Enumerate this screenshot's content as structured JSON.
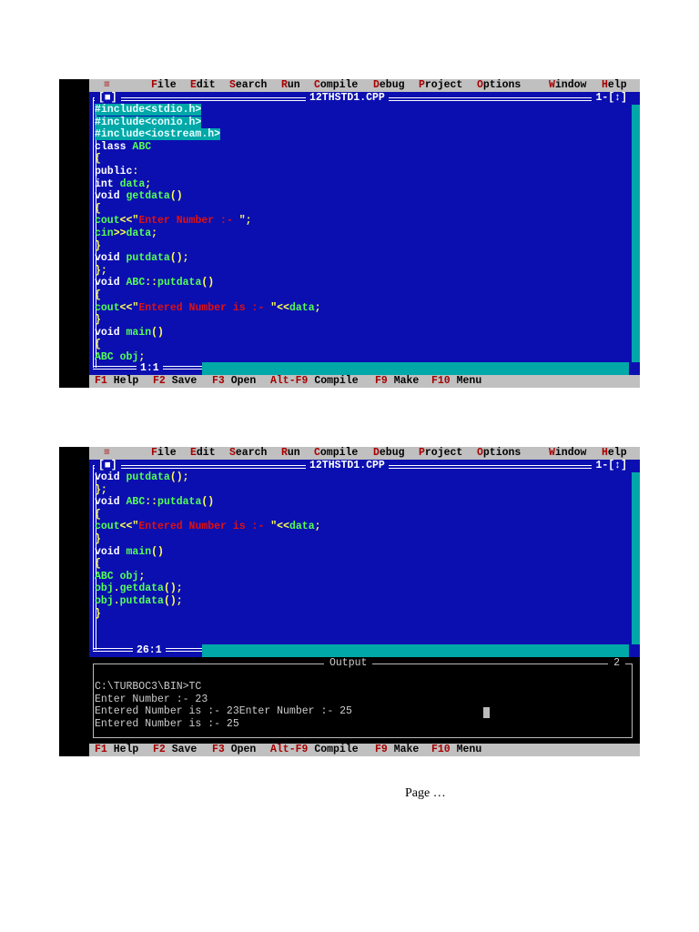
{
  "menu": {
    "system": "≡",
    "items": [
      {
        "hot": "F",
        "rest": "ile"
      },
      {
        "hot": "E",
        "rest": "dit"
      },
      {
        "hot": "S",
        "rest": "earch"
      },
      {
        "hot": "R",
        "rest": "un"
      },
      {
        "hot": "C",
        "rest": "ompile"
      },
      {
        "hot": "D",
        "rest": "ebug"
      },
      {
        "hot": "P",
        "rest": "roject"
      },
      {
        "hot": "O",
        "rest": "ptions"
      },
      {
        "hot": "W",
        "rest": "indow"
      },
      {
        "hot": "H",
        "rest": "elp"
      }
    ]
  },
  "status": [
    {
      "key": "F1",
      "label": "Help"
    },
    {
      "key": "F2",
      "label": "Save"
    },
    {
      "key": "F3",
      "label": "Open"
    },
    {
      "key": "Alt-F9",
      "label": "Compile"
    },
    {
      "key": "F9",
      "label": "Make"
    },
    {
      "key": "F10",
      "label": "Menu"
    }
  ],
  "editor": {
    "filename": "12THSTD1.CPP",
    "close_box": "[■]",
    "window_number": "1",
    "zoom_box": "[↕]"
  },
  "shot1": {
    "cursor_pos": "1:1",
    "code": [
      [
        [
          "#include<stdio.h>",
          "hl"
        ]
      ],
      [
        [
          "#include<conio.h>",
          "hl"
        ]
      ],
      [
        [
          "#include<iostream.h>",
          "hl"
        ]
      ],
      [
        [
          "class ",
          "k"
        ],
        [
          "ABC",
          "i"
        ]
      ],
      [
        [
          "{",
          "p"
        ]
      ],
      [
        [
          "public",
          "k"
        ],
        [
          ":",
          "p"
        ]
      ],
      [
        [
          "int ",
          "k"
        ],
        [
          "data",
          "i"
        ],
        [
          ";",
          "p"
        ]
      ],
      [
        [
          "void ",
          "k"
        ],
        [
          "getdata",
          "i"
        ],
        [
          "()",
          "p"
        ]
      ],
      [
        [
          "{",
          "p"
        ]
      ],
      [
        [
          "cout",
          "i"
        ],
        [
          "<<\"",
          "p"
        ],
        [
          "Enter Number :- ",
          "s"
        ],
        [
          "\";",
          "p"
        ]
      ],
      [
        [
          "cin",
          "i"
        ],
        [
          ">>",
          "p"
        ],
        [
          "data",
          "i"
        ],
        [
          ";",
          "p"
        ]
      ],
      [
        [
          "}",
          "p"
        ]
      ],
      [
        [
          "void ",
          "k"
        ],
        [
          "putdata",
          "i"
        ],
        [
          "();",
          "p"
        ]
      ],
      [
        [
          "};",
          "p"
        ]
      ],
      [
        [
          "void ",
          "k"
        ],
        [
          "ABC",
          "i"
        ],
        [
          "::",
          "p"
        ],
        [
          "putdata",
          "i"
        ],
        [
          "()",
          "p"
        ]
      ],
      [
        [
          "{",
          "p"
        ]
      ],
      [
        [
          "cout",
          "i"
        ],
        [
          "<<\"",
          "p"
        ],
        [
          "Entered Number is :- ",
          "s"
        ],
        [
          "\"<<",
          "p"
        ],
        [
          "data",
          "i"
        ],
        [
          ";",
          "p"
        ]
      ],
      [
        [
          "}",
          "p"
        ]
      ],
      [
        [
          "void ",
          "k"
        ],
        [
          "main",
          "i"
        ],
        [
          "()",
          "p"
        ]
      ],
      [
        [
          "{",
          "p"
        ]
      ],
      [
        [
          "ABC obj",
          "i"
        ],
        [
          ";",
          "p"
        ]
      ]
    ]
  },
  "shot2": {
    "cursor_pos": "26:1",
    "code": [
      [
        [
          "void ",
          "k"
        ],
        [
          "putdata",
          "i"
        ],
        [
          "();",
          "p"
        ]
      ],
      [
        [
          "};",
          "p"
        ]
      ],
      [
        [
          "void ",
          "k"
        ],
        [
          "ABC",
          "i"
        ],
        [
          "::",
          "p"
        ],
        [
          "putdata",
          "i"
        ],
        [
          "()",
          "p"
        ]
      ],
      [
        [
          "{",
          "p"
        ]
      ],
      [
        [
          "cout",
          "i"
        ],
        [
          "<<\"",
          "p"
        ],
        [
          "Entered Number is :- ",
          "s"
        ],
        [
          "\"<<",
          "p"
        ],
        [
          "data",
          "i"
        ],
        [
          ";",
          "p"
        ]
      ],
      [
        [
          "}",
          "p"
        ]
      ],
      [
        [
          "void ",
          "k"
        ],
        [
          "main",
          "i"
        ],
        [
          "()",
          "p"
        ]
      ],
      [
        [
          "{",
          "p"
        ]
      ],
      [
        [
          "ABC obj",
          "i"
        ],
        [
          ";",
          "p"
        ]
      ],
      [
        [
          "obj",
          "i"
        ],
        [
          ".",
          "p"
        ],
        [
          "getdata",
          "i"
        ],
        [
          "();",
          "p"
        ]
      ],
      [
        [
          "obj",
          "i"
        ],
        [
          ".",
          "p"
        ],
        [
          "putdata",
          "i"
        ],
        [
          "();",
          "p"
        ]
      ],
      [
        [
          "}",
          "p"
        ]
      ]
    ],
    "output": {
      "title": "Output",
      "window_number": "2",
      "lines": [
        "C:\\TURBOC3\\BIN>TC",
        "Enter Number :- 23",
        "Entered Number is :- 23Enter Number :- 25",
        "Entered Number is :- 25"
      ]
    }
  },
  "footer": "Page …"
}
